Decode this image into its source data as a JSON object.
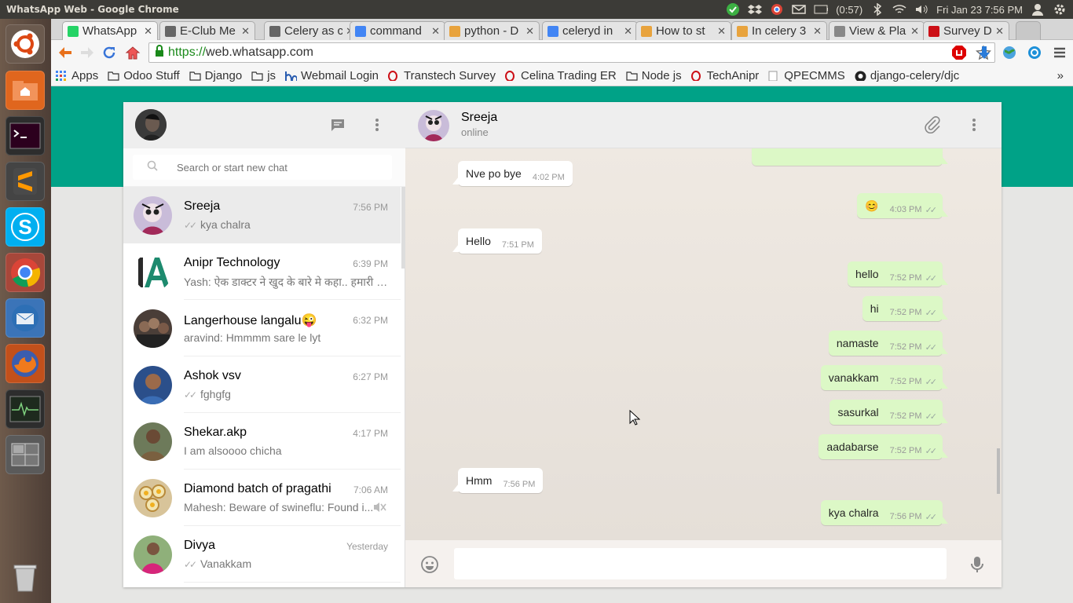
{
  "system_bar": {
    "window_title": "WhatsApp Web - Google Chrome",
    "battery": "(0:57)",
    "clock": "Fri Jan 23  7:56 PM"
  },
  "browser": {
    "tabs": [
      {
        "label": "WhatsApp",
        "color": "#25d366"
      },
      {
        "label": "E-Club Me",
        "color": "#666666"
      },
      {
        "label": "Celery as c",
        "color": "#666666"
      },
      {
        "label": "command",
        "color": "#4285f4"
      },
      {
        "label": "python - D",
        "color": "#e8a33d"
      },
      {
        "label": "celeryd in",
        "color": "#4285f4"
      },
      {
        "label": "How to st",
        "color": "#e8a33d"
      },
      {
        "label": "In celery 3",
        "color": "#e8a33d"
      },
      {
        "label": "View & Pla",
        "color": "#888888"
      },
      {
        "label": "Survey De",
        "color": "#cc0f16"
      }
    ],
    "url_scheme": "https://",
    "url_host": "web.whatsapp.com",
    "bookmarks": [
      {
        "label": "Apps",
        "icon": "apps-grid-icon"
      },
      {
        "label": "Odoo Stuff",
        "icon": "folder-icon"
      },
      {
        "label": "Django",
        "icon": "folder-icon"
      },
      {
        "label": "js",
        "icon": "folder-icon"
      },
      {
        "label": "Webmail Login",
        "icon": "webmail-icon"
      },
      {
        "label": "Transtech Survey",
        "icon": "opera-icon"
      },
      {
        "label": "Celina Trading ER",
        "icon": "opera-icon"
      },
      {
        "label": "Node js",
        "icon": "folder-icon"
      },
      {
        "label": "TechAnipr",
        "icon": "opera-icon"
      },
      {
        "label": "QPECMMS",
        "icon": "page-icon"
      },
      {
        "label": "django-celery/djc",
        "icon": "github-icon"
      }
    ],
    "more_bookmarks": "»"
  },
  "whatsapp": {
    "search_placeholder": "Search or start new chat",
    "chats": [
      {
        "name": "Sreeja",
        "time": "7:56 PM",
        "last": "kya chalra",
        "ticks": true,
        "active": true
      },
      {
        "name": "Anipr Technology",
        "time": "6:39 PM",
        "last": "Yash: ऐक डाक्टर ने खुद के बारे मे कहा.. हमारी श…",
        "ticks": false
      },
      {
        "name": "Langerhouse langalu😜",
        "time": "6:32 PM",
        "last": "aravind: Hmmmm sare le lyt",
        "ticks": false
      },
      {
        "name": "Ashok vsv",
        "time": "6:27 PM",
        "last": "fghgfg",
        "ticks": true
      },
      {
        "name": "Shekar.akp",
        "time": "4:17 PM",
        "last": "I am alsoooo chicha",
        "ticks": false
      },
      {
        "name": "Diamond batch of pragathi",
        "time": "7:06 AM",
        "last": "Mahesh: Beware of swineflu: Found i...",
        "ticks": false,
        "muted": true
      },
      {
        "name": "Divya",
        "time": "Yesterday",
        "last": "Vanakkam",
        "ticks": true
      }
    ],
    "contact": {
      "name": "Sreeja",
      "status": "online"
    },
    "messages": [
      {
        "dir": "in",
        "text": "Nve po bye",
        "time": "4:02 PM"
      },
      {
        "dir": "out",
        "text": "😊",
        "time": "4:03 PM"
      },
      {
        "dir": "in",
        "text": "Hello",
        "time": "7:51 PM"
      },
      {
        "dir": "out",
        "text": "hello",
        "time": "7:52 PM"
      },
      {
        "dir": "out",
        "text": "hi",
        "time": "7:52 PM"
      },
      {
        "dir": "out",
        "text": "namaste",
        "time": "7:52 PM"
      },
      {
        "dir": "out",
        "text": "vanakkam",
        "time": "7:52 PM"
      },
      {
        "dir": "out",
        "text": "sasurkal",
        "time": "7:52 PM"
      },
      {
        "dir": "out",
        "text": "aadabarse",
        "time": "7:52 PM"
      },
      {
        "dir": "in",
        "text": "Hmm",
        "time": "7:56 PM"
      },
      {
        "dir": "out",
        "text": "kya chalra",
        "time": "7:56 PM"
      }
    ],
    "composer_value": ""
  }
}
